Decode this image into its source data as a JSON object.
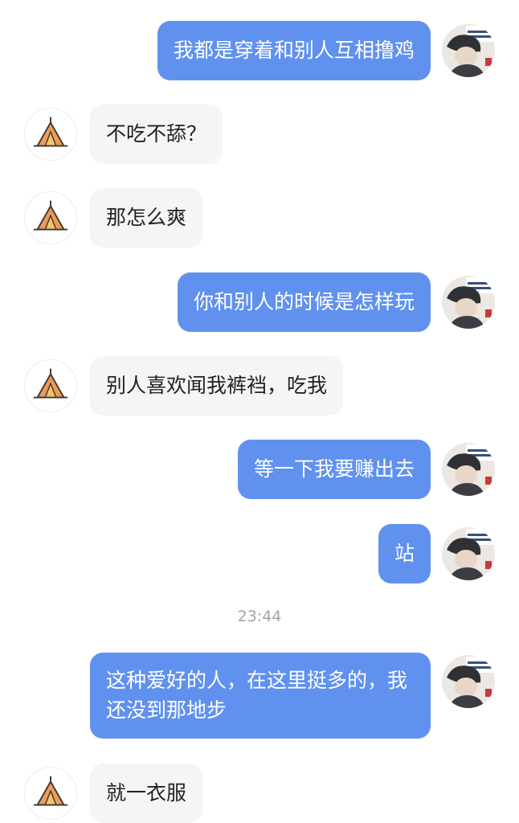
{
  "messages": [
    {
      "side": "me",
      "text": "我都是穿着和别人互相撸鸡"
    },
    {
      "side": "them",
      "text": "不吃不舔？"
    },
    {
      "side": "them",
      "text": "那怎么爽"
    },
    {
      "side": "me",
      "text": "你和别人的时候是怎样玩"
    },
    {
      "side": "them",
      "text": "别人喜欢闻我裤裆，吃我"
    },
    {
      "side": "me",
      "text": "等一下我要赚出去"
    },
    {
      "side": "me",
      "text": "站"
    },
    {
      "side": "me",
      "text": "这种爱好的人，在这里挺多的，我还没到那地步"
    },
    {
      "side": "them",
      "text": "就一衣服"
    }
  ],
  "timestamp": "23:44",
  "colors": {
    "my_bubble": "#6091ee",
    "their_bubble": "#f5f5f5",
    "tent_icon": "#f09a55"
  },
  "icons": {
    "their_avatar": "tent-icon",
    "my_avatar": "user-photo"
  }
}
